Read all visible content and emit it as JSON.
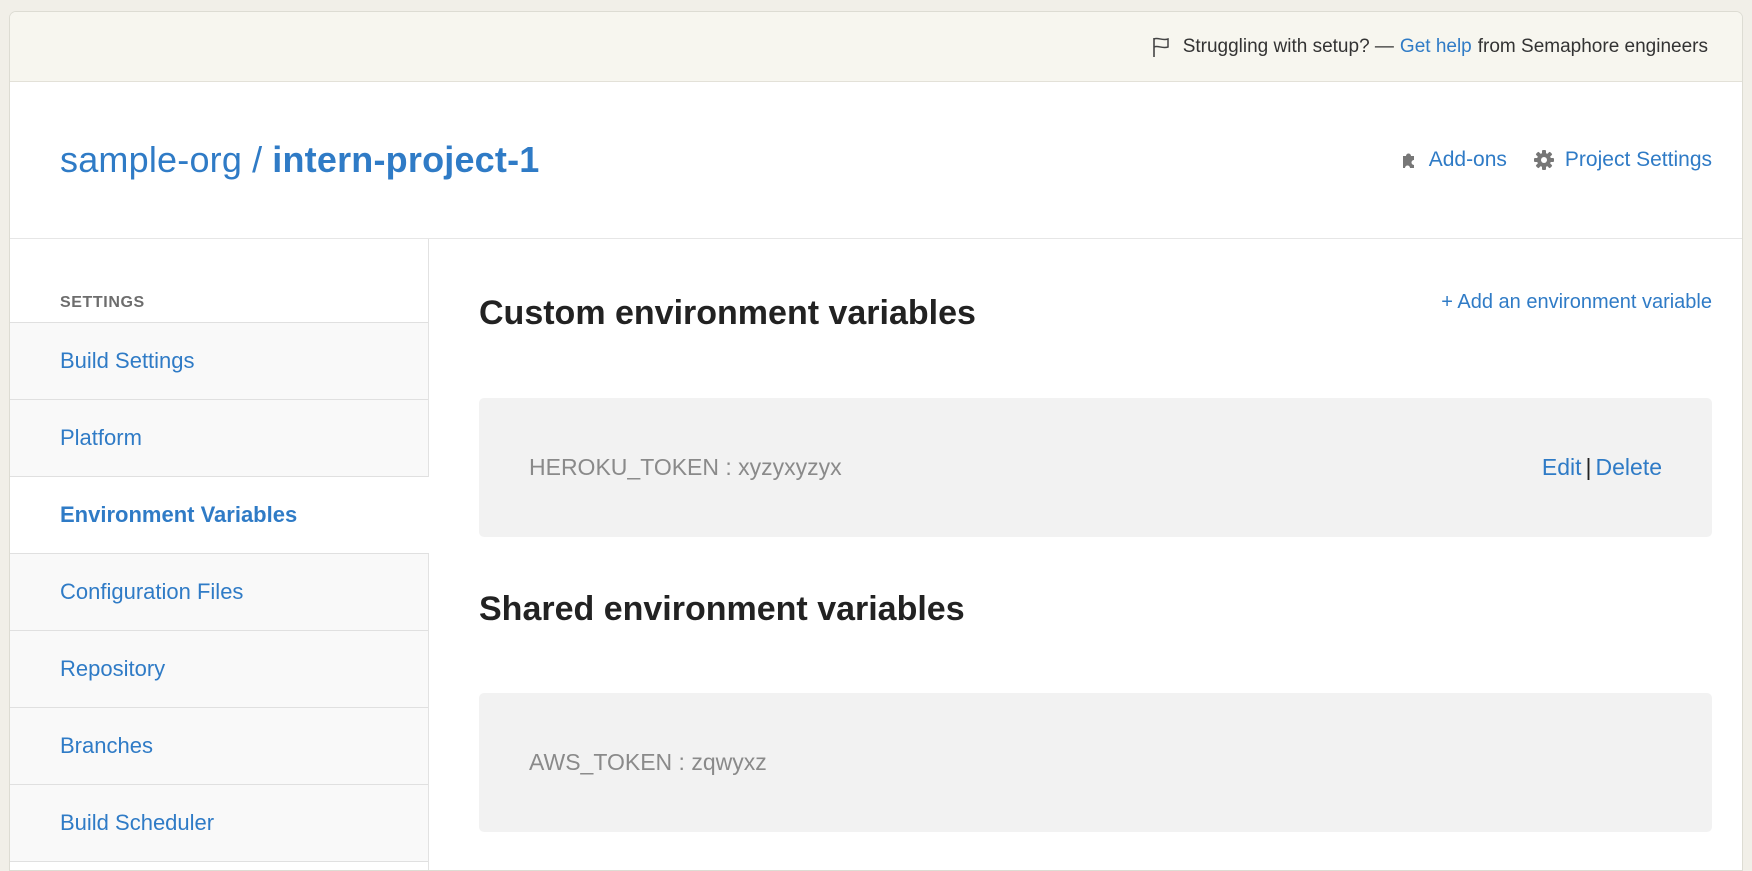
{
  "help_bar": {
    "prefix": "Struggling with setup? —",
    "link": "Get help",
    "suffix": "from Semaphore engineers"
  },
  "header": {
    "org": "sample-org",
    "separator": "/",
    "project": "intern-project-1",
    "nav": {
      "addons": "Add-ons",
      "project_settings": "Project Settings"
    }
  },
  "sidebar": {
    "heading": "SETTINGS",
    "items": [
      {
        "label": "Build Settings"
      },
      {
        "label": "Platform"
      },
      {
        "label": "Environment Variables",
        "active": true
      },
      {
        "label": "Configuration Files"
      },
      {
        "label": "Repository"
      },
      {
        "label": "Branches"
      },
      {
        "label": "Build Scheduler"
      }
    ]
  },
  "main": {
    "custom": {
      "title": "Custom environment variables",
      "add_link": "+ Add an environment variable",
      "variable": "HEROKU_TOKEN : xyzyxyzyx",
      "edit": "Edit",
      "divider": "|",
      "delete": "Delete"
    },
    "shared": {
      "title": "Shared environment variables",
      "variable": "AWS_TOKEN : zqwyxz"
    }
  },
  "colors": {
    "link": "#2f7bc6",
    "help_bar_bg": "#f7f6ef",
    "var_box_bg": "#f2f2f2"
  }
}
